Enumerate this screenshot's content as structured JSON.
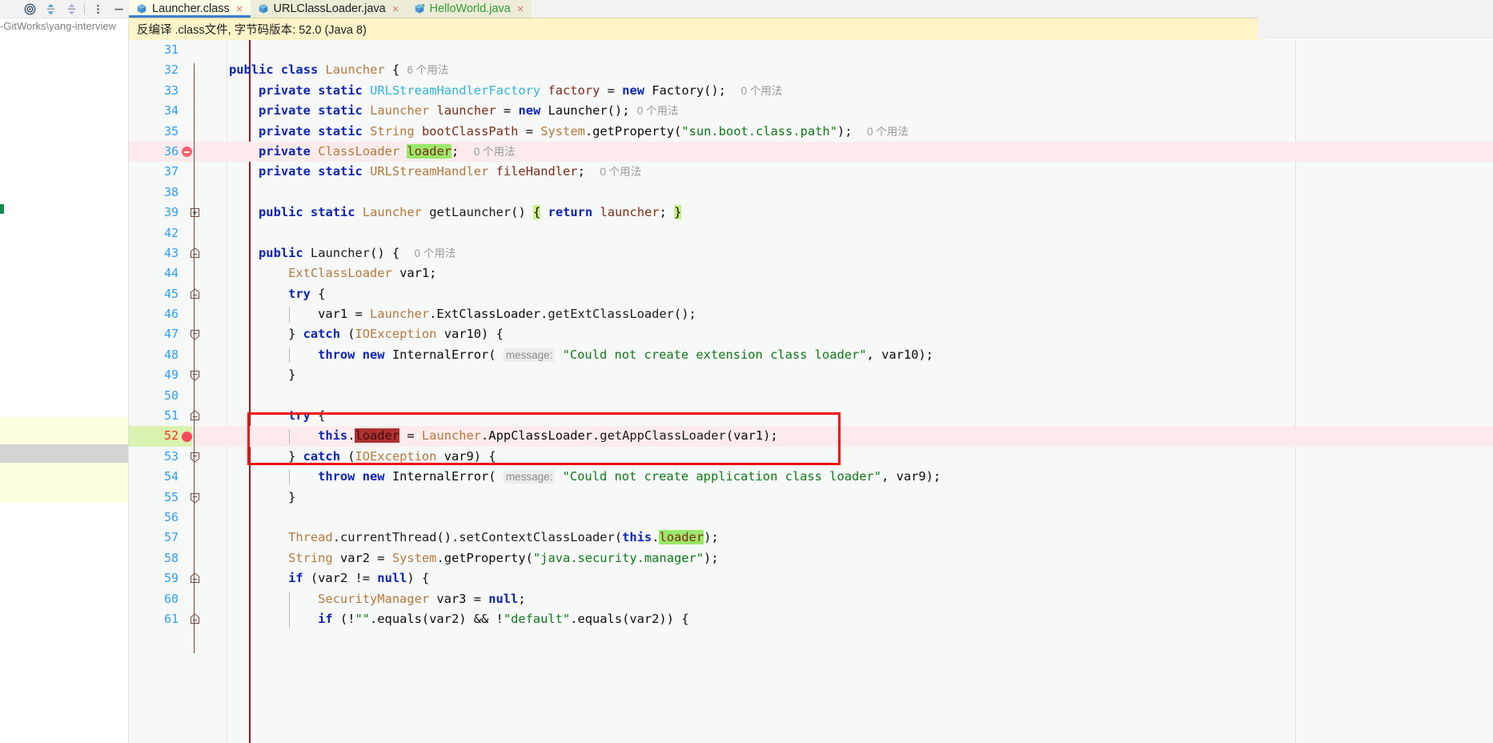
{
  "left_panel": {
    "toolbar_icons": [
      "locate-target-icon",
      "expand-all-icon",
      "collapse-all-icon",
      "more-options-icon",
      "hide-panel-icon"
    ],
    "path_text": "-GitWorks\\yang-interview "
  },
  "tabs": [
    {
      "label": "Launcher.class",
      "active": true,
      "modified": false,
      "close": "×",
      "icon": "java-class-file-icon"
    },
    {
      "label": "URLClassLoader.java",
      "active": false,
      "modified": false,
      "close": "×",
      "icon": "java-file-icon"
    },
    {
      "label": "HelloWorld.java",
      "active": false,
      "modified": true,
      "close": "×",
      "icon": "java-file-modified-icon"
    }
  ],
  "notification": {
    "text": "反编译 .class文件, 字节码版本: 52.0 (Java 8)"
  },
  "editor": {
    "first_line": 31,
    "breakpoint_lines": [
      36,
      52
    ],
    "current_line": 52,
    "lines": [
      {
        "n": "31",
        "indent": 0,
        "tokens": []
      },
      {
        "n": "32",
        "indent": 0,
        "fold": "none",
        "tokens": [
          {
            "t": "public",
            "c": "kw"
          },
          {
            "t": " ",
            "c": ""
          },
          {
            "t": "class",
            "c": "kw"
          },
          {
            "t": " ",
            "c": ""
          },
          {
            "t": "Launcher",
            "c": "cls"
          },
          {
            "t": " { ",
            "c": ""
          },
          {
            "t": "6 个用法",
            "c": "usage"
          }
        ]
      },
      {
        "n": "33",
        "indent": 1,
        "tokens": [
          {
            "t": "private",
            "c": "kw"
          },
          {
            "t": " ",
            "c": ""
          },
          {
            "t": "static",
            "c": "kw"
          },
          {
            "t": " ",
            "c": ""
          },
          {
            "t": "URLStreamHandlerFactory",
            "c": "iface"
          },
          {
            "t": " ",
            "c": ""
          },
          {
            "t": "factory",
            "c": "fld"
          },
          {
            "t": " = ",
            "c": ""
          },
          {
            "t": "new",
            "c": "kw"
          },
          {
            "t": " Factory();  ",
            "c": ""
          },
          {
            "t": "0 个用法",
            "c": "usage"
          }
        ]
      },
      {
        "n": "34",
        "indent": 1,
        "tokens": [
          {
            "t": "private",
            "c": "kw"
          },
          {
            "t": " ",
            "c": ""
          },
          {
            "t": "static",
            "c": "kw"
          },
          {
            "t": " ",
            "c": ""
          },
          {
            "t": "Launcher",
            "c": "cls"
          },
          {
            "t": " ",
            "c": ""
          },
          {
            "t": "launcher",
            "c": "fld"
          },
          {
            "t": " = ",
            "c": ""
          },
          {
            "t": "new",
            "c": "kw"
          },
          {
            "t": " Launcher(); ",
            "c": ""
          },
          {
            "t": "0 个用法",
            "c": "usage"
          }
        ]
      },
      {
        "n": "35",
        "indent": 1,
        "tokens": [
          {
            "t": "private",
            "c": "kw"
          },
          {
            "t": " ",
            "c": ""
          },
          {
            "t": "static",
            "c": "kw"
          },
          {
            "t": " ",
            "c": ""
          },
          {
            "t": "String",
            "c": "cls"
          },
          {
            "t": " ",
            "c": ""
          },
          {
            "t": "bootClassPath",
            "c": "fld"
          },
          {
            "t": " = ",
            "c": ""
          },
          {
            "t": "System",
            "c": "cls"
          },
          {
            "t": ".getProperty(",
            "c": ""
          },
          {
            "t": "\"sun.boot.class.path\"",
            "c": "str"
          },
          {
            "t": ");  ",
            "c": ""
          },
          {
            "t": "0 个用法",
            "c": "usage"
          }
        ]
      },
      {
        "n": "36",
        "indent": 1,
        "error": true,
        "tokens": [
          {
            "t": "private",
            "c": "kw"
          },
          {
            "t": " ",
            "c": ""
          },
          {
            "t": "ClassLoader",
            "c": "cls"
          },
          {
            "t": " ",
            "c": ""
          },
          {
            "t": "loader",
            "c": "fld hl-green"
          },
          {
            "t": ";  ",
            "c": ""
          },
          {
            "t": "0 个用法",
            "c": "usage"
          }
        ]
      },
      {
        "n": "37",
        "indent": 1,
        "tokens": [
          {
            "t": "private",
            "c": "kw"
          },
          {
            "t": " ",
            "c": ""
          },
          {
            "t": "static",
            "c": "kw"
          },
          {
            "t": " ",
            "c": ""
          },
          {
            "t": "URLStreamHandler",
            "c": "cls"
          },
          {
            "t": " ",
            "c": ""
          },
          {
            "t": "fileHandler",
            "c": "fld"
          },
          {
            "t": ";  ",
            "c": ""
          },
          {
            "t": "0 个用法",
            "c": "usage"
          }
        ]
      },
      {
        "n": "38",
        "indent": 0,
        "tokens": []
      },
      {
        "n": "39",
        "indent": 1,
        "fold": "plus",
        "tokens": [
          {
            "t": "public",
            "c": "kw"
          },
          {
            "t": " ",
            "c": ""
          },
          {
            "t": "static",
            "c": "kw"
          },
          {
            "t": " ",
            "c": ""
          },
          {
            "t": "Launcher",
            "c": "cls"
          },
          {
            "t": " ",
            "c": ""
          },
          {
            "t": "getLauncher",
            "c": "mth"
          },
          {
            "t": "() ",
            "c": ""
          },
          {
            "t": "{",
            "c": "hl-brace"
          },
          {
            "t": " ",
            "c": ""
          },
          {
            "t": "return",
            "c": "kw"
          },
          {
            "t": " ",
            "c": ""
          },
          {
            "t": "launcher",
            "c": "fld"
          },
          {
            "t": "; ",
            "c": ""
          },
          {
            "t": "}",
            "c": "hl-brace"
          }
        ]
      },
      {
        "n": "42",
        "indent": 0,
        "tokens": []
      },
      {
        "n": "43",
        "indent": 1,
        "fold": "minus-top",
        "tokens": [
          {
            "t": "public",
            "c": "kw"
          },
          {
            "t": " ",
            "c": ""
          },
          {
            "t": "Launcher",
            "c": "mth"
          },
          {
            "t": "() {  ",
            "c": ""
          },
          {
            "t": "0 个用法",
            "c": "usage"
          }
        ]
      },
      {
        "n": "44",
        "indent": 2,
        "tokens": [
          {
            "t": "ExtClassLoader",
            "c": "cls"
          },
          {
            "t": " var1;",
            "c": ""
          }
        ]
      },
      {
        "n": "45",
        "indent": 2,
        "fold": "minus-top",
        "tokens": [
          {
            "t": "try",
            "c": "kw"
          },
          {
            "t": " {",
            "c": ""
          }
        ]
      },
      {
        "n": "46",
        "indent": 3,
        "tokens": [
          {
            "t": "var1 = ",
            "c": ""
          },
          {
            "t": "Launcher",
            "c": "cls"
          },
          {
            "t": ".ExtClassLoader.",
            "c": ""
          },
          {
            "t": "getExtClassLoader",
            "c": "mth"
          },
          {
            "t": "();",
            "c": ""
          }
        ]
      },
      {
        "n": "47",
        "indent": 2,
        "fold": "minus-mid",
        "tokens": [
          {
            "t": "} ",
            "c": ""
          },
          {
            "t": "catch",
            "c": "kw"
          },
          {
            "t": " (",
            "c": ""
          },
          {
            "t": "IOException",
            "c": "cls"
          },
          {
            "t": " var10) {",
            "c": ""
          }
        ]
      },
      {
        "n": "48",
        "indent": 3,
        "tokens": [
          {
            "t": "throw",
            "c": "kw"
          },
          {
            "t": " ",
            "c": ""
          },
          {
            "t": "new",
            "c": "kw"
          },
          {
            "t": " InternalError( ",
            "c": ""
          },
          {
            "t": "message:",
            "c": "hint"
          },
          {
            "t": " ",
            "c": ""
          },
          {
            "t": "\"Could not create extension class loader\"",
            "c": "str"
          },
          {
            "t": ", var10);",
            "c": ""
          }
        ]
      },
      {
        "n": "49",
        "indent": 2,
        "fold": "minus-bot",
        "tokens": [
          {
            "t": "}",
            "c": ""
          }
        ]
      },
      {
        "n": "50",
        "indent": 0,
        "tokens": []
      },
      {
        "n": "51",
        "indent": 2,
        "fold": "minus-top",
        "tokens": [
          {
            "t": "try",
            "c": "kw"
          },
          {
            "t": " {",
            "c": ""
          }
        ]
      },
      {
        "n": "52",
        "indent": 3,
        "error": true,
        "current": true,
        "tokens": [
          {
            "t": "this",
            "c": "kw"
          },
          {
            "t": ".",
            "c": ""
          },
          {
            "t": "loader",
            "c": "hl-dark"
          },
          {
            "t": " = ",
            "c": ""
          },
          {
            "t": "Launcher",
            "c": "cls"
          },
          {
            "t": ".AppClassLoader.",
            "c": ""
          },
          {
            "t": "getAppClassLoader",
            "c": "mth"
          },
          {
            "t": "(var1);",
            "c": ""
          }
        ]
      },
      {
        "n": "53",
        "indent": 2,
        "fold": "minus-mid",
        "tokens": [
          {
            "t": "} ",
            "c": ""
          },
          {
            "t": "catch",
            "c": "kw"
          },
          {
            "t": " (",
            "c": ""
          },
          {
            "t": "IOException",
            "c": "cls"
          },
          {
            "t": " var9) {",
            "c": ""
          }
        ]
      },
      {
        "n": "54",
        "indent": 3,
        "tokens": [
          {
            "t": "throw",
            "c": "kw"
          },
          {
            "t": " ",
            "c": ""
          },
          {
            "t": "new",
            "c": "kw"
          },
          {
            "t": " InternalError( ",
            "c": ""
          },
          {
            "t": "message:",
            "c": "hint"
          },
          {
            "t": " ",
            "c": ""
          },
          {
            "t": "\"Could not create application class loader\"",
            "c": "str"
          },
          {
            "t": ", var9);",
            "c": ""
          }
        ]
      },
      {
        "n": "55",
        "indent": 2,
        "fold": "minus-bot",
        "tokens": [
          {
            "t": "}",
            "c": ""
          }
        ]
      },
      {
        "n": "56",
        "indent": 0,
        "tokens": []
      },
      {
        "n": "57",
        "indent": 2,
        "tokens": [
          {
            "t": "Thread",
            "c": "cls"
          },
          {
            "t": ".",
            "c": ""
          },
          {
            "t": "currentThread",
            "c": "mth"
          },
          {
            "t": "().",
            "c": ""
          },
          {
            "t": "setContextClassLoader",
            "c": "mth"
          },
          {
            "t": "(",
            "c": ""
          },
          {
            "t": "this",
            "c": "kw"
          },
          {
            "t": ".",
            "c": ""
          },
          {
            "t": "loader",
            "c": "fld hl-green"
          },
          {
            "t": ");",
            "c": ""
          }
        ]
      },
      {
        "n": "58",
        "indent": 2,
        "tokens": [
          {
            "t": "String",
            "c": "cls"
          },
          {
            "t": " var2 = ",
            "c": ""
          },
          {
            "t": "System",
            "c": "cls"
          },
          {
            "t": ".getProperty(",
            "c": ""
          },
          {
            "t": "\"java.security.manager\"",
            "c": "str"
          },
          {
            "t": ");",
            "c": ""
          }
        ]
      },
      {
        "n": "59",
        "indent": 2,
        "fold": "minus-top",
        "tokens": [
          {
            "t": "if",
            "c": "kw"
          },
          {
            "t": " (var2 != ",
            "c": ""
          },
          {
            "t": "null",
            "c": "kw"
          },
          {
            "t": ") {",
            "c": ""
          }
        ]
      },
      {
        "n": "60",
        "indent": 3,
        "tokens": [
          {
            "t": "SecurityManager",
            "c": "cls"
          },
          {
            "t": " var3 = ",
            "c": ""
          },
          {
            "t": "null",
            "c": "kw"
          },
          {
            "t": ";",
            "c": ""
          }
        ]
      },
      {
        "n": "61",
        "indent": 3,
        "fold": "minus-top",
        "tokens": [
          {
            "t": "if",
            "c": "kw"
          },
          {
            "t": " (!",
            "c": ""
          },
          {
            "t": "\"\"",
            "c": "str"
          },
          {
            "t": ".equals(var2) && !",
            "c": ""
          },
          {
            "t": "\"default\"",
            "c": "str"
          },
          {
            "t": ".equals(var2)) {",
            "c": ""
          }
        ]
      }
    ]
  },
  "annotation": {
    "shape": "rectangle",
    "color": "#ee1111",
    "around_line": 52
  }
}
